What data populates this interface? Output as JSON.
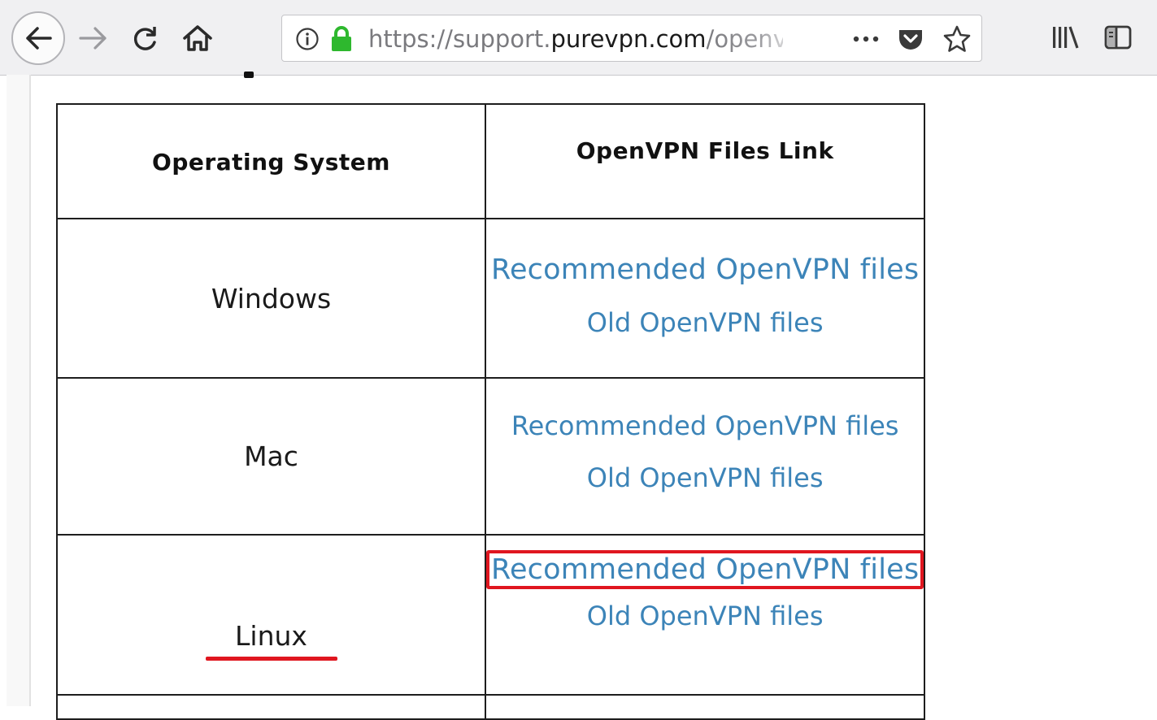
{
  "browser": {
    "url_prefix": "https://support.",
    "url_domain": "purevpn.com",
    "url_suffix": "/openvp",
    "icons": {
      "back": "back-arrow-icon",
      "forward": "forward-arrow-icon",
      "reload": "reload-icon",
      "home": "home-icon",
      "info": "info-icon",
      "lock": "lock-icon",
      "more": "more-icon",
      "pocket": "pocket-icon",
      "bookmark": "star-icon",
      "library": "library-icon",
      "sidebar": "sidebar-icon"
    },
    "colors": {
      "lock": "#2eb82e",
      "toolbar": "#f0f0f2"
    }
  },
  "table": {
    "headers": [
      "Operating System",
      "OpenVPN Files Link"
    ],
    "rows": [
      {
        "os": "Windows",
        "recommended": "Recommended OpenVPN files",
        "old": "Old OpenVPN files"
      },
      {
        "os": "Mac",
        "recommended": "Recommended OpenVPN files",
        "old": "Old OpenVPN files"
      },
      {
        "os": "Linux",
        "recommended": "Recommended OpenVPN files",
        "old": "Old OpenVPN files"
      }
    ]
  },
  "annotations": {
    "highlight_color": "#e0161f",
    "link_color": "#3c84b8"
  }
}
